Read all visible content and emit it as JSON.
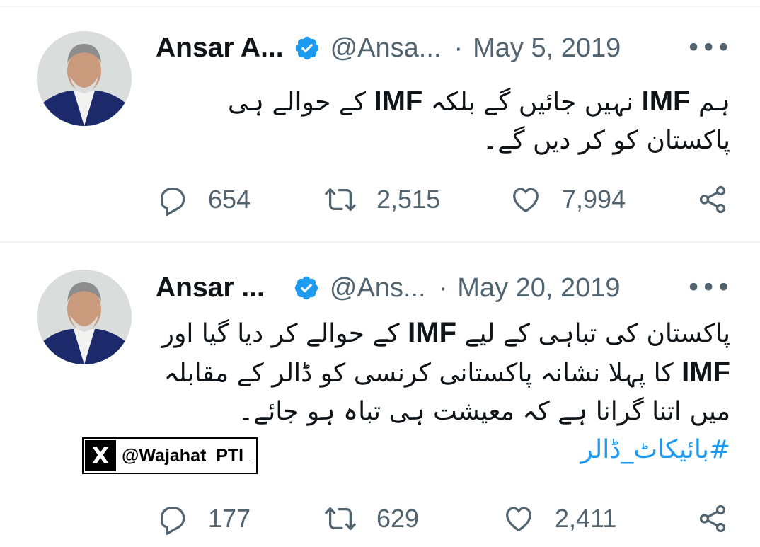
{
  "tweets": [
    {
      "author_name": "Ansar A...",
      "handle": "@Ansa...",
      "separator": "·",
      "date": "May 5, 2019",
      "more_label": "•••",
      "body_lines": [
        {
          "pre": "ہم ",
          "bold": "IMF",
          "mid": " نہیں جائیں گے بلکہ ",
          "bold2": "IMF",
          "post": " کے حوالے ہی"
        },
        {
          "pre": "پاکستان کو کر دیں گے۔",
          "bold": "",
          "mid": "",
          "bold2": "",
          "post": ""
        }
      ],
      "hashtag": "",
      "replies": "654",
      "retweets": "2,515",
      "likes": "7,994"
    },
    {
      "author_name": "Ansar ...",
      "handle": "@Ans...",
      "separator": "·",
      "date": "May 20, 2019",
      "more_label": "•••",
      "body_lines": [
        {
          "pre": "پاکستان کی تباہی کے لیے ",
          "bold": "IMF",
          "mid": " کے حوالے کر دیا گیا اور",
          "bold2": "",
          "post": ""
        },
        {
          "pre": "",
          "bold": "IMF",
          "mid": " کا پہلا نشانہ پاکستانی کرنسی کو ڈالر کے مقابلہ",
          "bold2": "",
          "post": ""
        },
        {
          "pre": "میں اتنا گرانا ہے کہ معیشت ہی تباہ ہو جائے۔",
          "bold": "",
          "mid": "",
          "bold2": "",
          "post": ""
        }
      ],
      "hashtag": "#بائیکاٹ_ڈالر",
      "replies": "177",
      "retweets": "629",
      "likes": "2,411"
    }
  ],
  "watermark": {
    "logo": "X",
    "text": "@Wajahat_PTI_"
  },
  "colors": {
    "text": "#0f1419",
    "secondary": "#536471",
    "accent": "#1d9bf0",
    "divider": "#eff3f4"
  },
  "icons": [
    "reply-icon",
    "retweet-icon",
    "like-icon",
    "share-icon",
    "verified-icon",
    "more-icon"
  ]
}
